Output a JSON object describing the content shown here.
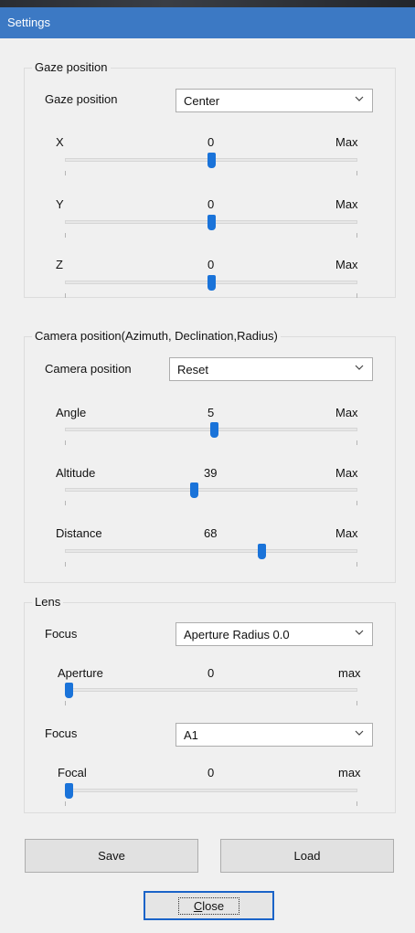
{
  "window": {
    "title": "Settings"
  },
  "gaze": {
    "group_label": "Gaze position",
    "combo_label": "Gaze position",
    "combo_value": "Center",
    "sliders": [
      {
        "label": "X",
        "value": "0",
        "max_label": "Max",
        "level": 0.5
      },
      {
        "label": "Y",
        "value": "0",
        "max_label": "Max",
        "level": 0.5
      },
      {
        "label": "Z",
        "value": "0",
        "max_label": "Max",
        "level": 0.5
      }
    ]
  },
  "camera": {
    "group_label": "Camera position(Azimuth, Declination,Radius)",
    "combo_label": "Camera position",
    "combo_value": "Reset",
    "sliders": [
      {
        "label": "Angle",
        "value": "5",
        "max_label": "Max",
        "level": 0.51
      },
      {
        "label": "Altitude",
        "value": "39",
        "max_label": "Max",
        "level": 0.44
      },
      {
        "label": "Distance",
        "value": "68",
        "max_label": "Max",
        "level": 0.68
      }
    ]
  },
  "lens": {
    "group_label": "Lens",
    "focus1_label": "Focus",
    "focus1_value": "Aperture Radius 0.0",
    "aperture": {
      "label": "Aperture",
      "value": "0",
      "max_label": "max",
      "level": 0.0
    },
    "focus2_label": "Focus",
    "focus2_value": "A1",
    "focal": {
      "label": "Focal",
      "value": "0",
      "max_label": "max",
      "level": 0.0
    }
  },
  "buttons": {
    "save": "Save",
    "load": "Load",
    "close_accel": "C",
    "close_rest": "lose"
  }
}
